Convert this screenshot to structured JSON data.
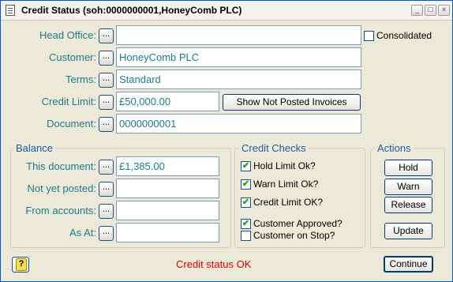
{
  "window": {
    "title": "Credit Status (soh:0000000001,HoneyComb PLC)",
    "min_glyph": "_",
    "max_glyph": "□",
    "close_glyph": "×"
  },
  "form": {
    "head_office": {
      "label": "Head Office:",
      "value": ""
    },
    "customer": {
      "label": "Customer:",
      "value": "HoneyComb PLC"
    },
    "terms": {
      "label": "Terms:",
      "value": "Standard"
    },
    "credit_limit": {
      "label": "Credit Limit:",
      "value": "£50,000.00"
    },
    "document": {
      "label": "Document:",
      "value": " 0000000001"
    },
    "lookup_glyph": "...",
    "consolidated": {
      "label": "Consolidated",
      "checked": false
    },
    "show_not_posted_label": "Show Not Posted Invoices"
  },
  "balance": {
    "legend": "Balance",
    "this_document": {
      "label": "This document:",
      "value": "£1,385.00"
    },
    "not_yet_posted": {
      "label": "Not yet posted:",
      "value": ""
    },
    "from_accounts": {
      "label": "From accounts:",
      "value": ""
    },
    "as_at": {
      "label": "As At:",
      "value": ""
    }
  },
  "credit_checks": {
    "legend": "Credit Checks",
    "check_glyph": "✔",
    "items": [
      {
        "label": "Hold Limit Ok?",
        "checked": true
      },
      {
        "label": "Warn Limit Ok?",
        "checked": true
      },
      {
        "label": "Credit Limit OK?",
        "checked": true
      },
      {
        "label": "Customer Approved?",
        "checked": true
      },
      {
        "label": "Customer on Stop?",
        "checked": false
      }
    ]
  },
  "actions": {
    "legend": "Actions",
    "hold": "Hold",
    "warn": "Warn",
    "release": "Release",
    "update": "Update"
  },
  "footer": {
    "status": "Credit status OK",
    "status_color": "#e00000",
    "continue_label": "Continue",
    "help_glyph": "?"
  }
}
